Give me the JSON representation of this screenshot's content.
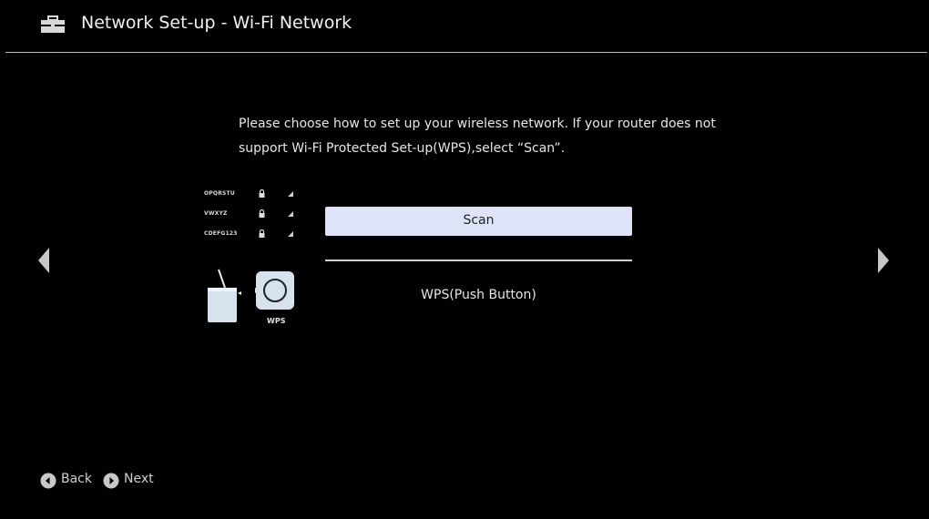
{
  "header": {
    "icon": "toolbox-icon",
    "title": "Network Set-up - Wi-Fi Network"
  },
  "instructions": {
    "line1": "Please choose how to set up your wireless network. If your router does not",
    "line2": "support Wi-Fi Protected Set-up(WPS),select “Scan”."
  },
  "illustration": {
    "networks": [
      {
        "name": "OPQRSTU"
      },
      {
        "name": "VWXYZ"
      },
      {
        "name": "CDEFG123"
      }
    ],
    "wps_label": "WPS"
  },
  "options": [
    {
      "label": "Scan",
      "selected": true
    },
    {
      "label": "WPS(Push Button)",
      "selected": false
    }
  ],
  "nav": {
    "left_arrow": "chevron-left-icon",
    "right_arrow": "chevron-right-icon"
  },
  "footer": {
    "back_label": "Back",
    "next_label": "Next"
  },
  "colors": {
    "background": "#000000",
    "selected_option": "#dfe3f7",
    "text": "#e6e6e6"
  }
}
